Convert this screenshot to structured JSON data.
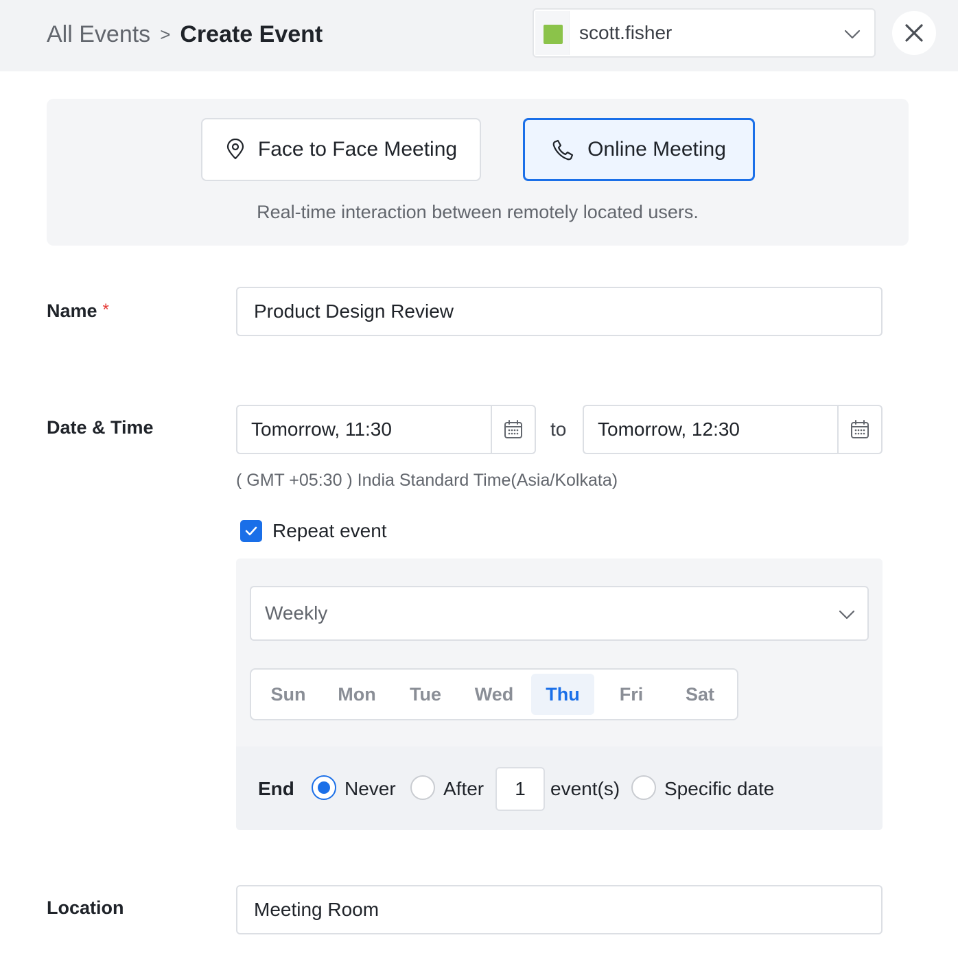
{
  "header": {
    "breadcrumb_parent": "All Events",
    "breadcrumb_separator": ">",
    "breadcrumb_current": "Create Event",
    "user": {
      "name": "scott.fisher",
      "color": "#8bc34a"
    }
  },
  "event_type": {
    "options": [
      {
        "label": "Face to Face Meeting",
        "icon": "location-pin-icon",
        "selected": false
      },
      {
        "label": "Online Meeting",
        "icon": "phone-icon",
        "selected": true
      }
    ],
    "description": "Real-time interaction between remotely located users."
  },
  "form": {
    "name": {
      "label": "Name",
      "required_mark": "*",
      "value": "Product Design Review"
    },
    "datetime": {
      "label": "Date & Time",
      "start": "Tomorrow, 11:30",
      "separator": "to",
      "end": "Tomorrow, 12:30",
      "timezone": "( GMT +05:30 ) India Standard Time(Asia/Kolkata)"
    },
    "repeat": {
      "label": "Repeat event",
      "checked": true,
      "frequency": "Weekly",
      "days": [
        {
          "label": "Sun",
          "selected": false
        },
        {
          "label": "Mon",
          "selected": false
        },
        {
          "label": "Tue",
          "selected": false
        },
        {
          "label": "Wed",
          "selected": false
        },
        {
          "label": "Thu",
          "selected": true
        },
        {
          "label": "Fri",
          "selected": false
        },
        {
          "label": "Sat",
          "selected": false
        }
      ],
      "end": {
        "label": "End",
        "never_label": "Never",
        "after_label": "After",
        "after_count": "1",
        "events_label": "event(s)",
        "specific_label": "Specific date",
        "selected": "Never"
      }
    },
    "location": {
      "label": "Location",
      "value": "Meeting Room"
    }
  },
  "colors": {
    "accent": "#1a6fe8",
    "required": "#e53935"
  }
}
